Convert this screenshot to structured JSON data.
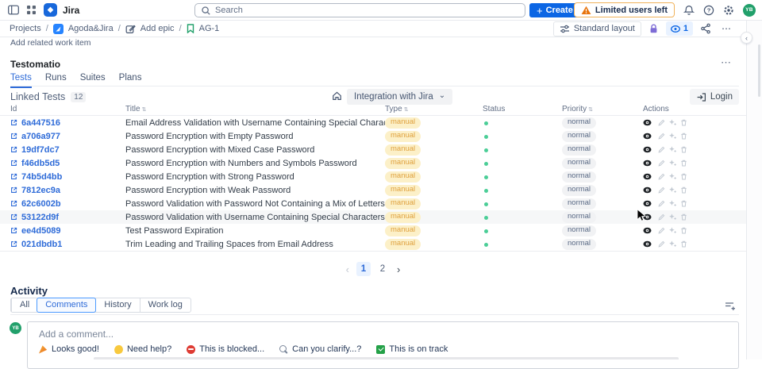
{
  "colors": {
    "accent_blue": "#0C66E4",
    "link_blue": "#2E6BD8",
    "tab_blue": "#2E6BD8",
    "warning_orange": "#E8740C",
    "status_green": "#4BCE97",
    "lock_purple": "#7E6CD6",
    "avatar_green": "#22A06B",
    "manual_bg": "#FCF0C8",
    "manual_text": "#DFA13E",
    "normal_bg": "#F1F2F4",
    "normal_text": "#5A6A85",
    "eye_pill_bg": "#E9F2FF"
  },
  "icons": {
    "plus": "+",
    "more": "⋯",
    "chevron_down": "⌄",
    "pagination_prev": "‹",
    "pagination_next": "›",
    "panel_collapse": "‹"
  },
  "header": {
    "app_name": "Jira",
    "search_placeholder": "Search",
    "create_label": "Create",
    "warning_label": "Limited users left",
    "avatar_initials": "YB"
  },
  "breadcrumb": {
    "separator": "/",
    "projects": "Projects",
    "project": "Agoda&Jira",
    "add_epic": "Add epic",
    "issue": "AG-1",
    "standard_layout": "Standard layout",
    "watchers_count": "1"
  },
  "page": {
    "add_related_hint": "Add related work item"
  },
  "testomatio": {
    "title": "Testomatio",
    "tabs": [
      {
        "label": "Tests",
        "active": true
      },
      {
        "label": "Runs"
      },
      {
        "label": "Suites"
      },
      {
        "label": "Plans"
      }
    ],
    "linked_tests_label": "Linked Tests",
    "linked_tests_count": "12",
    "integration_dropdown": "Integration with Jira",
    "login_label": "Login",
    "table": {
      "columns": [
        {
          "label": "Id"
        },
        {
          "label": "Title",
          "sortable": true
        },
        {
          "label": "Type",
          "sortable": true
        },
        {
          "label": "Status"
        },
        {
          "label": "Priority",
          "sortable": true
        },
        {
          "label": "Actions"
        }
      ],
      "rows": [
        {
          "id": "6a447516",
          "title": "Email Address Validation with Username Containing Special Characters",
          "type": "manual",
          "priority": "normal"
        },
        {
          "id": "a706a977",
          "title": "Password Encryption with Empty Password",
          "type": "manual",
          "priority": "normal"
        },
        {
          "id": "19df7dc7",
          "title": "Password Encryption with Mixed Case Password",
          "type": "manual",
          "priority": "normal"
        },
        {
          "id": "f46db5d5",
          "title": "Password Encryption with Numbers and Symbols Password",
          "type": "manual",
          "priority": "normal"
        },
        {
          "id": "74b5d4bb",
          "title": "Password Encryption with Strong Password",
          "type": "manual",
          "priority": "normal"
        },
        {
          "id": "7812ec9a",
          "title": "Password Encryption with Weak Password",
          "type": "manual",
          "priority": "normal"
        },
        {
          "id": "62c6002b",
          "title": "Password Validation with Password Not Containing a Mix of Letters and Numbers",
          "type": "manual",
          "priority": "normal"
        },
        {
          "id": "53122d9f",
          "title": "Password Validation with Username Containing Special Characters",
          "type": "manual",
          "priority": "normal",
          "hovered": true
        },
        {
          "id": "ee4d5089",
          "title": "Test Password Expiration",
          "type": "manual",
          "priority": "normal"
        },
        {
          "id": "021dbdb1",
          "title": "Trim Leading and Trailing Spaces from Email Address",
          "type": "manual",
          "priority": "normal"
        }
      ]
    },
    "pagination": {
      "pages": [
        {
          "label": "1",
          "current": true
        },
        {
          "label": "2"
        }
      ]
    }
  },
  "activity": {
    "title": "Activity",
    "tabs": [
      {
        "label": "All"
      },
      {
        "label": "Comments",
        "active": true
      },
      {
        "label": "History"
      },
      {
        "label": "Work log"
      }
    ],
    "avatar_initials": "YB",
    "comment_placeholder": "Add a comment...",
    "quick_replies": [
      {
        "icon": "party",
        "label": "Looks good!"
      },
      {
        "icon": "wave",
        "label": "Need help?"
      },
      {
        "icon": "blocked",
        "label": "This is blocked..."
      },
      {
        "icon": "magnifier",
        "label": "Can you clarify...?"
      },
      {
        "icon": "check",
        "label": "This is on track"
      }
    ]
  }
}
